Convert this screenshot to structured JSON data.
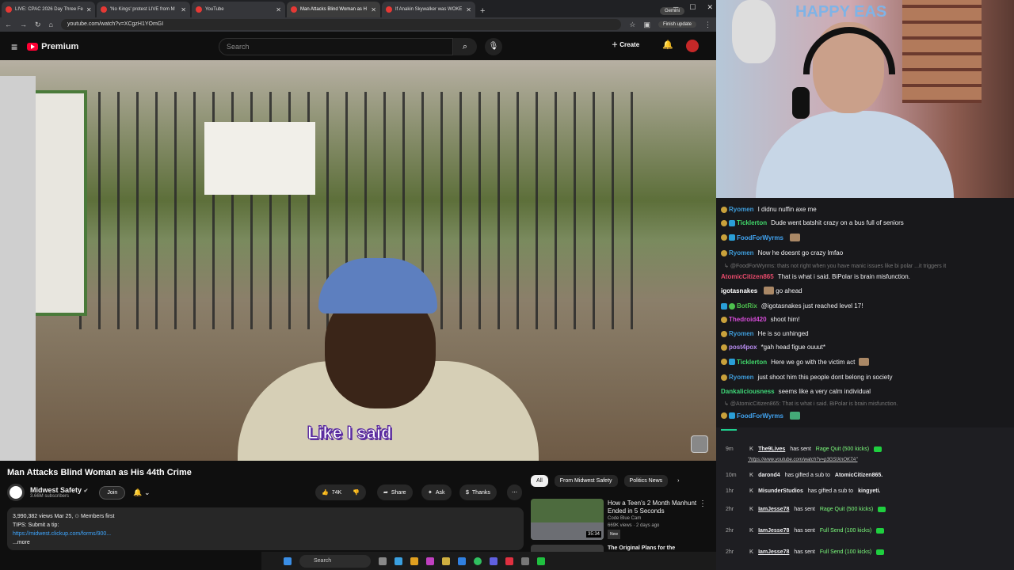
{
  "browser": {
    "tabs": [
      {
        "title": "LIVE: CPAC 2026 Day Three Fe"
      },
      {
        "title": "'No Kings' protest LIVE from M"
      },
      {
        "title": "YouTube"
      },
      {
        "title": "Man Attacks Blind Woman as H"
      },
      {
        "title": "If Anakin Skywalker was WOKE"
      }
    ],
    "new_tab": "+",
    "gemini": "Gemini",
    "url": "youtube.com/watch?v=XCgzH1YOmGI",
    "finish_update": "Finish update"
  },
  "youtube": {
    "logo_text": "Premium",
    "search_placeholder": "Search",
    "create_label": "Create",
    "subtitle": "Like I said",
    "video_title": "Man Attacks Blind Woman as His 44th Crime",
    "channel_name": "Midwest Safety",
    "channel_subs": "3.66M subscribers",
    "join_label": "Join",
    "likes": "74K",
    "share_label": "Share",
    "ask_label": "Ask",
    "thanks_label": "Thanks",
    "description": {
      "stats": "3,990,382 views  Mar 25,",
      "members": "Members first",
      "tips": "TIPS: Submit a tip:",
      "link": "https://midwest.clickup.com/forms/900...",
      "more": "...more"
    },
    "chips": [
      "All",
      "From Midwest Safety",
      "Politics News"
    ],
    "related": {
      "title": "How a Teen's 2 Month Manhunt Ended in 5 Seconds",
      "channel": "Code Blue Cam",
      "meta": "669K views · 2 days ago",
      "badge": "New",
      "duration": "35:34",
      "next_title": "The Original Plans for the"
    }
  },
  "webcam_banner": "HAPPY EAS",
  "chat": [
    {
      "user": "Ryomen",
      "color": "#3e9bd8",
      "text": "I didnu nuffin axe me"
    },
    {
      "user": "Ticklerton",
      "color": "#41d86b",
      "text": "Dude went batshit crazy on a bus full of seniors"
    },
    {
      "user": "FoodForWyrms",
      "color": "#41a3f0",
      "text": ""
    },
    {
      "user": "Ryomen",
      "color": "#3e9bd8",
      "text": "Now he doesnt go crazy lmfao"
    },
    {
      "reply": "@FoodForWyrms: thats not right when you have manic issues like bi polar ...it triggers it"
    },
    {
      "user": "AtomicCitizen865",
      "color": "#e84a6b",
      "text": "That is what i said. BiPolar is brain misfunction."
    },
    {
      "user": "igotasnakes",
      "color": "#ffffff",
      "text": "go ahead"
    },
    {
      "user": "BotRix",
      "color": "#4ec04e",
      "text": "@igotasnakes just reached level 17!"
    },
    {
      "user": "Thedroid420",
      "color": "#d64dd8",
      "text": "shoot him!"
    },
    {
      "user": "Ryomen",
      "color": "#3e9bd8",
      "text": "He is so unhinged"
    },
    {
      "user": "post4pox",
      "color": "#b88cf0",
      "text": "*gah head figue ouuut*"
    },
    {
      "user": "Ticklerton",
      "color": "#41d86b",
      "text": "Here we go with the victim act"
    },
    {
      "user": "Ryomen",
      "color": "#3e9bd8",
      "text": "just shoot him this people dont belong in society"
    },
    {
      "user": "Dankaliciousness",
      "color": "#3fd878",
      "text": "seems like a very calm individual"
    },
    {
      "reply": "@AtomicCitizen865: That is what i said. BiPolar is brain misfunction."
    },
    {
      "user": "FoodForWyrms",
      "color": "#41a3f0",
      "text": ""
    }
  ],
  "events": [
    {
      "time": "9m",
      "user": "The9Lives",
      "action": "has sent",
      "gift": "Rage Quit (500 kicks)",
      "sub": "\"https://www.youtube.com/watch?v=p3GSIXnOK7A\""
    },
    {
      "time": "10m",
      "user": "darond4",
      "action": "has gifted a sub to",
      "gift": "AtomicCitizen865."
    },
    {
      "time": "1hr",
      "user": "MisunderStudios",
      "action": "has gifted a sub to",
      "gift": "kingyeti."
    },
    {
      "time": "2hr",
      "user": "IamJesse78",
      "action": "has sent",
      "gift": "Rage Quit (500 kicks)"
    },
    {
      "time": "2hr",
      "user": "IamJesse78",
      "action": "has sent",
      "gift": "Full Send (100 kicks)"
    },
    {
      "time": "2hr",
      "user": "IamJesse78",
      "action": "has sent",
      "gift": "Full Send (100 kicks)"
    }
  ],
  "taskbar": {
    "search_placeholder": "Search"
  }
}
